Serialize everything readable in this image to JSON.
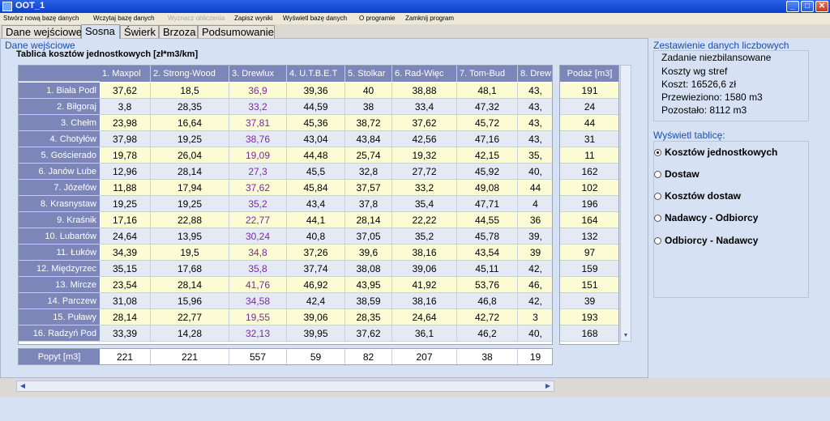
{
  "window": {
    "title": "OOT_1",
    "min": "_",
    "max": "□",
    "close": "✕"
  },
  "menu": [
    {
      "label": "Stwórz nową bazę danych",
      "disabled": false
    },
    {
      "label": "Wczytaj bazę danych",
      "disabled": false
    },
    {
      "label": "Wyznacz obliczenia",
      "disabled": true
    },
    {
      "label": "Zapisz wyniki",
      "disabled": false
    },
    {
      "label": "Wyświetl bazę danych",
      "disabled": false
    },
    {
      "label": "O programie",
      "disabled": false
    },
    {
      "label": "Zamknij program",
      "disabled": false
    }
  ],
  "tabs": [
    "Dane wejściowe",
    "Sosna",
    "Świerk",
    "Brzoza",
    "Podsumowanie"
  ],
  "active_tab": 1,
  "section_title": "Dane wejściowe",
  "table_title": "Tablica kosztów jednostkowych [zł*m3/km]",
  "columns": [
    "1. Maxpol",
    "2. Strong-Wood",
    "3. Drewlux",
    "4. U.T.B.E.T",
    "5. Stolkar",
    "6. Rad-Więc",
    "7. Tom-Bud",
    "8. Drew"
  ],
  "rows": [
    {
      "name": "1. Biała Podl",
      "vals": [
        "37,62",
        "18,5",
        "36,9",
        "39,36",
        "40",
        "38,88",
        "48,1",
        "43,"
      ],
      "supply": "191"
    },
    {
      "name": "2. Biłgoraj",
      "vals": [
        "3,8",
        "28,35",
        "33,2",
        "44,59",
        "38",
        "33,4",
        "47,32",
        "43,"
      ],
      "supply": "24"
    },
    {
      "name": "3. Chełm",
      "vals": [
        "23,98",
        "16,64",
        "37,81",
        "45,36",
        "38,72",
        "37,62",
        "45,72",
        "43,"
      ],
      "supply": "44"
    },
    {
      "name": "4. Chotyłów",
      "vals": [
        "37,98",
        "19,25",
        "38,76",
        "43,04",
        "43,84",
        "42,56",
        "47,16",
        "43,"
      ],
      "supply": "31"
    },
    {
      "name": "5. Gościerado",
      "vals": [
        "19,78",
        "26,04",
        "19,09",
        "44,48",
        "25,74",
        "19,32",
        "42,15",
        "35,"
      ],
      "supply": "11"
    },
    {
      "name": "6. Janów Lube",
      "vals": [
        "12,96",
        "28,14",
        "27,3",
        "45,5",
        "32,8",
        "27,72",
        "45,92",
        "40,"
      ],
      "supply": "162"
    },
    {
      "name": "7. Józefów",
      "vals": [
        "11,88",
        "17,94",
        "37,62",
        "45,84",
        "37,57",
        "33,2",
        "49,08",
        "44"
      ],
      "supply": "102"
    },
    {
      "name": "8. Krasnystaw",
      "vals": [
        "19,25",
        "19,25",
        "35,2",
        "43,4",
        "37,8",
        "35,4",
        "47,71",
        "4"
      ],
      "supply": "196"
    },
    {
      "name": "9. Kraśnik",
      "vals": [
        "17,16",
        "22,88",
        "22,77",
        "44,1",
        "28,14",
        "22,22",
        "44,55",
        "36"
      ],
      "supply": "164"
    },
    {
      "name": "10. Lubartów",
      "vals": [
        "24,64",
        "13,95",
        "30,24",
        "40,8",
        "37,05",
        "35,2",
        "45,78",
        "39,"
      ],
      "supply": "132"
    },
    {
      "name": "11. Łuków",
      "vals": [
        "34,39",
        "19,5",
        "34,8",
        "37,26",
        "39,6",
        "38,16",
        "43,54",
        "39"
      ],
      "supply": "97"
    },
    {
      "name": "12. Międzyrzec",
      "vals": [
        "35,15",
        "17,68",
        "35,8",
        "37,74",
        "38,08",
        "39,06",
        "45,11",
        "42,"
      ],
      "supply": "159"
    },
    {
      "name": "13. Mircze",
      "vals": [
        "23,54",
        "28,14",
        "41,76",
        "46,92",
        "43,95",
        "41,92",
        "53,76",
        "46,"
      ],
      "supply": "151"
    },
    {
      "name": "14. Parczew",
      "vals": [
        "31,08",
        "15,96",
        "34,58",
        "42,4",
        "38,59",
        "38,16",
        "46,8",
        "42,"
      ],
      "supply": "39"
    },
    {
      "name": "15. Puławy",
      "vals": [
        "28,14",
        "22,77",
        "19,55",
        "39,06",
        "28,35",
        "24,64",
        "42,72",
        "3"
      ],
      "supply": "193"
    },
    {
      "name": "16. Radzyń Pod",
      "vals": [
        "33,39",
        "14,28",
        "32,13",
        "39,95",
        "37,62",
        "36,1",
        "46,2",
        "40,"
      ],
      "supply": "168"
    }
  ],
  "supply_header": "Podaż [m3]",
  "demand": {
    "label": "Popyt [m3]",
    "vals": [
      "221",
      "221",
      "557",
      "59",
      "82",
      "207",
      "38",
      "19"
    ]
  },
  "stats": {
    "title": "Zestawienie danych liczbowych",
    "lines": [
      "Zadanie niezbilansowane",
      "Koszty wg stref",
      "Koszt:  16526,6 zł",
      "Przewieziono:  1580 m3",
      "Pozostało:  8112 m3"
    ]
  },
  "view": {
    "title": "Wyświetl tablicę:",
    "options": [
      "Kosztów jednostkowych",
      "Dostaw",
      "Kosztów dostaw",
      "Nadawcy - Odbiorcy",
      "Odbiorcy - Nadawcy"
    ],
    "selected": 0
  },
  "colors": {
    "header": "#7c86b8",
    "odd": "#fbfbd4",
    "even": "#e4eaf4",
    "purple": "#7a2aa0",
    "accent": "#1a4fb0"
  }
}
